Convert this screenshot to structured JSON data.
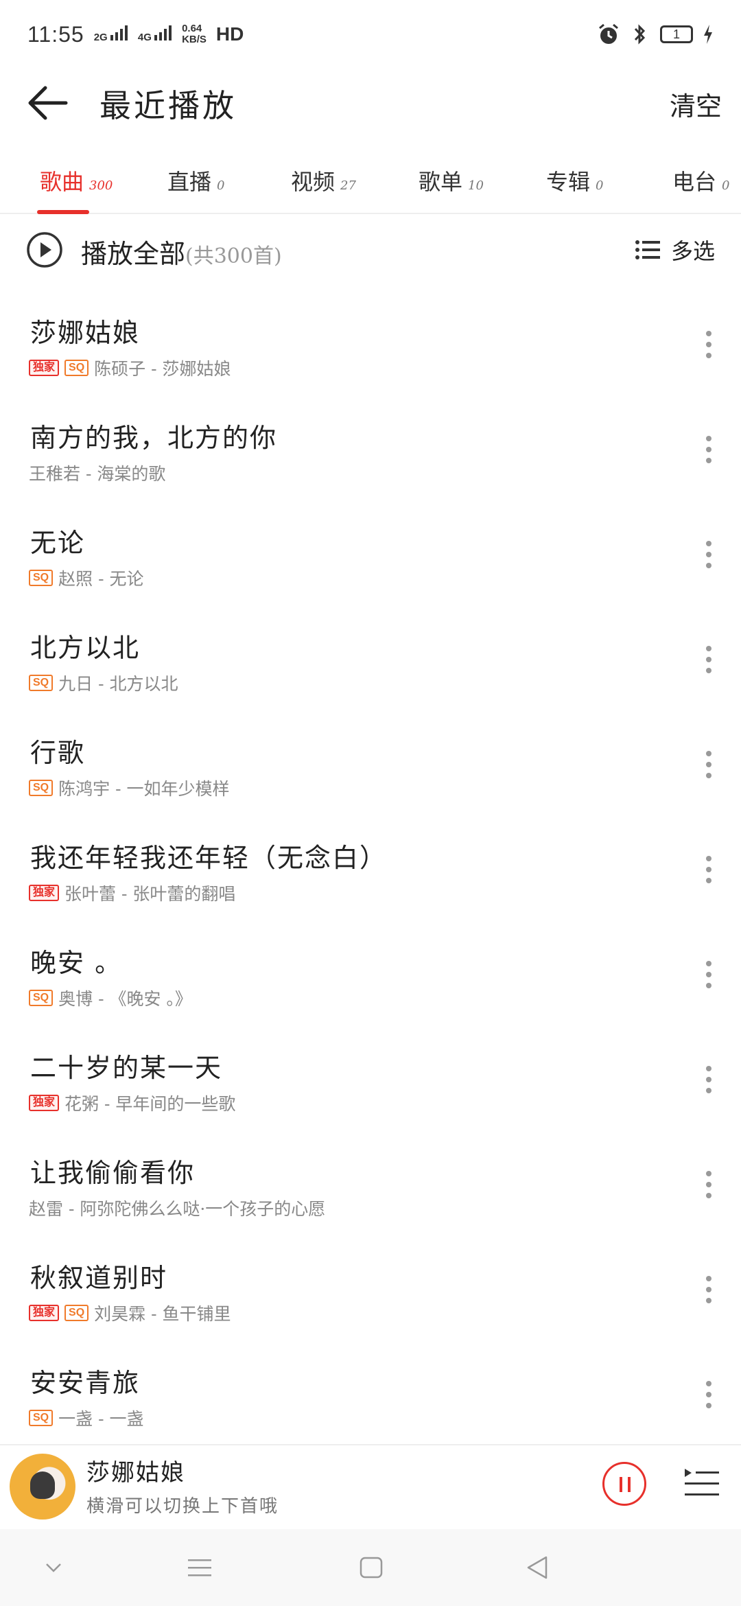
{
  "status_bar": {
    "time": "11:55",
    "network_1": "2G",
    "network_2": "4G",
    "speed": "0.64\nKB/S",
    "hd": "HD",
    "battery": "1"
  },
  "header": {
    "title": "最近播放",
    "clear_label": "清空"
  },
  "tabs": [
    {
      "label": "歌曲",
      "count": "300",
      "active": true
    },
    {
      "label": "直播",
      "count": "0"
    },
    {
      "label": "视频",
      "count": "27"
    },
    {
      "label": "歌单",
      "count": "10"
    },
    {
      "label": "专辑",
      "count": "0"
    },
    {
      "label": "电台",
      "count": "0"
    }
  ],
  "play_all": {
    "label": "播放全部",
    "count": "(共300首)",
    "multi_select": "多选"
  },
  "songs": [
    {
      "title": "莎娜姑娘",
      "subtitle": "陈硕子 - 莎娜姑娘",
      "badges": [
        "独家",
        "SQ"
      ]
    },
    {
      "title": "南方的我，北方的你",
      "subtitle": "王稚若 - 海棠的歌",
      "badges": []
    },
    {
      "title": "无论",
      "subtitle": "赵照 - 无论",
      "badges": [
        "SQ"
      ]
    },
    {
      "title": "北方以北",
      "subtitle": "九日 - 北方以北",
      "badges": [
        "SQ"
      ]
    },
    {
      "title": "行歌",
      "subtitle": "陈鸿宇 - 一如年少模样",
      "badges": [
        "SQ"
      ]
    },
    {
      "title": "我还年轻我还年轻（无念白）",
      "subtitle": "张叶蕾 - 张叶蕾的翻唱",
      "badges": [
        "独家"
      ]
    },
    {
      "title": "晚安 。",
      "subtitle": "奥博 - 《晚安 。》",
      "badges": [
        "SQ"
      ]
    },
    {
      "title": "二十岁的某一天",
      "subtitle": "花粥 - 早年间的一些歌",
      "badges": [
        "独家"
      ]
    },
    {
      "title": "让我偷偷看你",
      "subtitle": "赵雷 - 阿弥陀佛么么哒·一个孩子的心愿",
      "badges": []
    },
    {
      "title": "秋叙道别时",
      "subtitle": "刘昊霖 - 鱼干铺里",
      "badges": [
        "独家",
        "SQ"
      ]
    },
    {
      "title": "安安青旅",
      "subtitle": "一盏 - 一盏",
      "badges": [
        "SQ"
      ]
    }
  ],
  "now_playing": {
    "title": "莎娜姑娘",
    "hint": "横滑可以切换上下首哦"
  },
  "colors": {
    "accent": "#e7302b",
    "sq_badge": "#f07a2a"
  }
}
